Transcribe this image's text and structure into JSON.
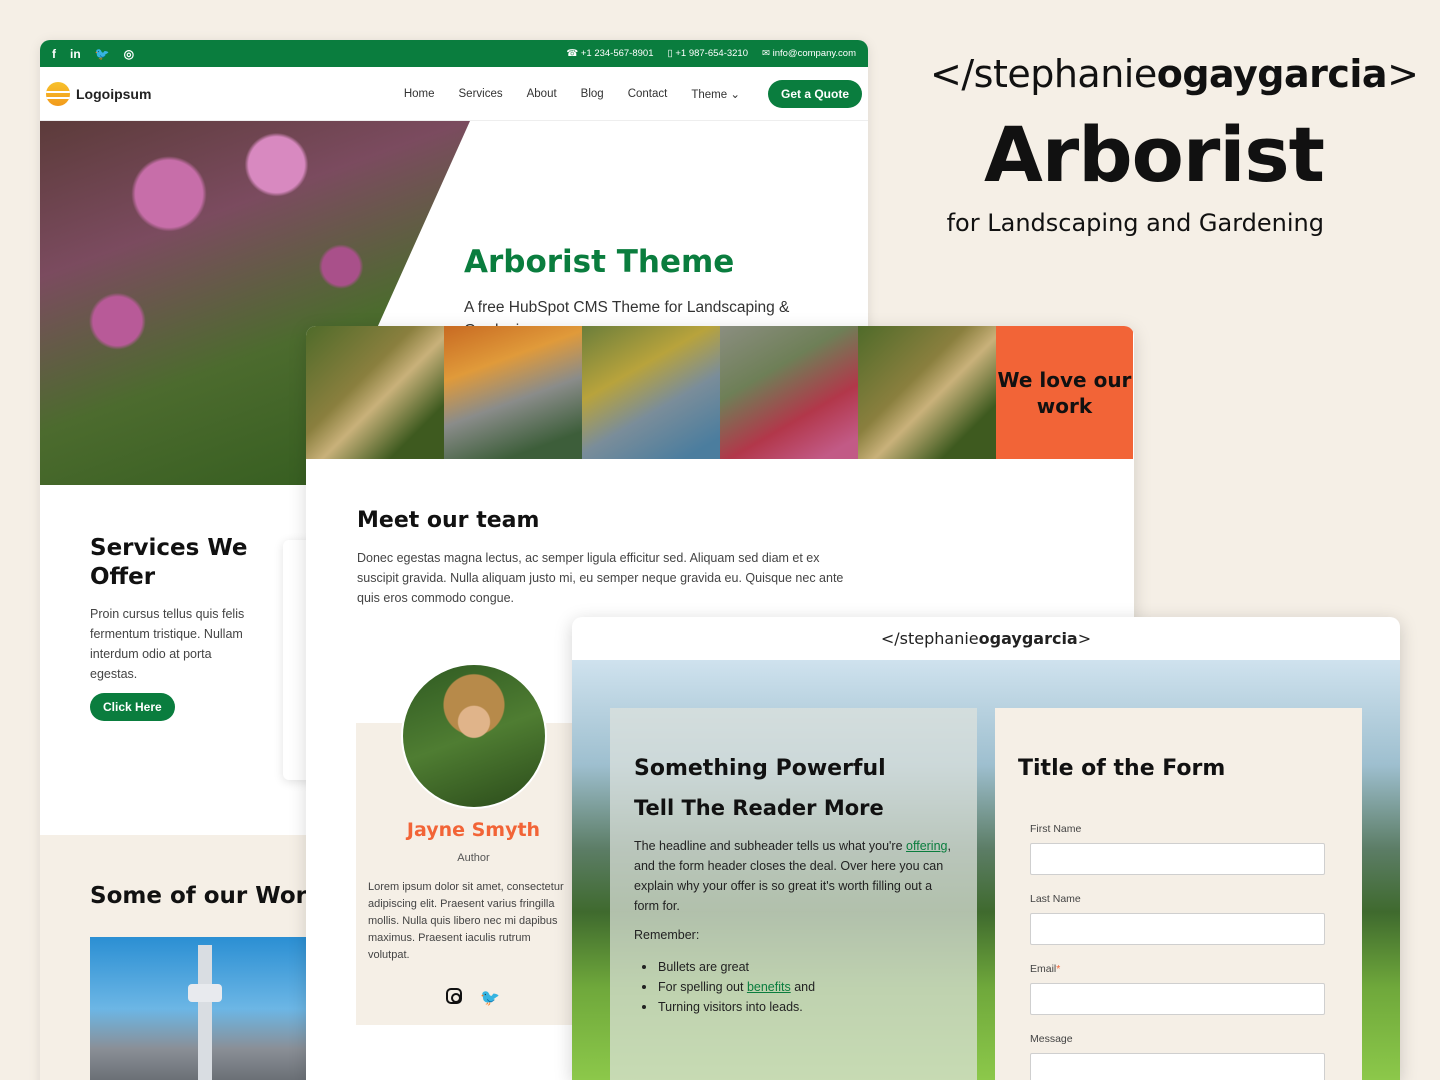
{
  "branding": {
    "handle_prefix": "</stephanie",
    "handle_bold": "ogaygarcia",
    "handle_suffix": ">",
    "title": "Arborist",
    "subtitle": "for Landscaping and Gardening"
  },
  "site": {
    "topbar": {
      "social_icons": [
        "facebook-icon",
        "linkedin-icon",
        "twitter-icon",
        "instagram-icon"
      ],
      "phone1": "+1 234-567-8901",
      "phone2": "+1 987-654-3210",
      "email": "info@company.com"
    },
    "logo_text": "Logoipsum",
    "nav": [
      "Home",
      "Services",
      "About",
      "Blog",
      "Contact",
      "Theme"
    ],
    "cta": "Get a Quote",
    "hero_title": "Arborist Theme",
    "hero_sub": "A free HubSpot CMS Theme for Landscaping & Gardening",
    "services_title": "Services We Offer",
    "services_text": "Proin cursus tellus quis felis fermentum tristique. Nullam interdum odio at porta egestas.",
    "services_btn": "Click Here",
    "work_title": "Some of our Work"
  },
  "team_page": {
    "gallery_badge": "We love our work",
    "title": "Meet our team",
    "intro": "Donec egestas magna lectus, ac semper ligula efficitur sed. Aliquam sed diam et ex suscipit gravida. Nulla aliquam justo mi, eu semper neque gravida eu. Quisque nec ante quis eros commodo congue.",
    "member": {
      "name": "Jayne Smyth",
      "role": "Author",
      "bio": "Lorem ipsum dolor sit amet, consectetur adipiscing elit. Praesent varius fringilla mollis. Nulla quis libero nec mi dapibus maximus. Praesent iaculis rutrum volutpat."
    }
  },
  "form_page": {
    "header_prefix": "</stephanie",
    "header_bold": "ogaygarcia",
    "header_suffix": ">",
    "headline": "Something Powerful",
    "subheadline": "Tell The Reader More",
    "body_before": "The headline and subheader tells us what you're ",
    "body_link": "offering",
    "body_after": ", and the form header closes the deal. Over here you can explain why your offer is so great it's worth filling out a form for.",
    "remember": "Remember:",
    "bullets": {
      "b1": "Bullets are great",
      "b2_before": "For spelling out ",
      "b2_link": "benefits",
      "b2_after": " and",
      "b3": "Turning visitors into leads."
    },
    "form_title": "Title of the Form",
    "fields": {
      "first_name": "First Name",
      "last_name": "Last Name",
      "email": "Email",
      "message": "Message"
    }
  },
  "colors": {
    "brand_green": "#0a7d3e",
    "accent_orange": "#f26437",
    "beige": "#f5efe6"
  }
}
